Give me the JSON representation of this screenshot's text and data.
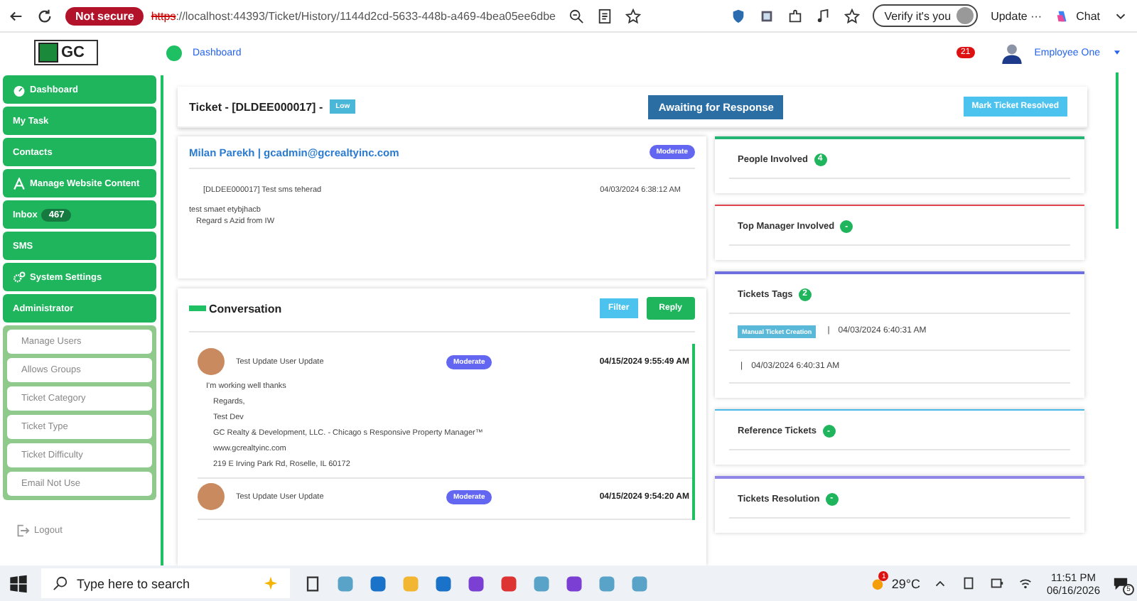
{
  "browser": {
    "security": "Not secure",
    "url_scheme": "https",
    "url_rest": "://localhost:44393/Ticket/History/1144d2cd-5633-448b-a469-4bea05ee6dbe",
    "verify": "Verify it's you",
    "update": "Update",
    "update_more": "···",
    "chat": "Chat"
  },
  "header": {
    "logo": "GC",
    "breadcrumb": "Dashboard",
    "notifications": "21",
    "user": "Employee One"
  },
  "sidebar": {
    "items": [
      {
        "label": "Dashboard",
        "kind": "dashboard"
      },
      {
        "label": "My Task",
        "kind": "plain"
      },
      {
        "label": "Contacts",
        "kind": "plain"
      },
      {
        "label": "Manage Website Content",
        "kind": "content"
      },
      {
        "label": "Inbox",
        "kind": "plain",
        "badge": "467"
      },
      {
        "label": "SMS",
        "kind": "plain"
      },
      {
        "label": "System Settings",
        "kind": "settings"
      },
      {
        "label": "Administrator",
        "kind": "plain",
        "expanded": true,
        "children": [
          "Manage Users",
          "Allows Groups",
          "Ticket Category",
          "Ticket Type",
          "Ticket Difficulty",
          "Email Not Use"
        ]
      }
    ],
    "logout": "Logout"
  },
  "ticket": {
    "title": "Ticket - [DLDEE000017] -",
    "priority": "Low",
    "status_button": "Awaiting for Response",
    "resolve_button": "Mark Ticket Resolved"
  },
  "message": {
    "sender": "Milan Parekh | gcadmin@gcrealtyinc.com",
    "badge": "Moderate",
    "subject": "[DLDEE000017] Test sms teherad",
    "date": "04/03/2024 6:38:12 AM",
    "body": [
      "test smaet etybjhacb",
      "Regard s Azid from IW"
    ]
  },
  "conversation": {
    "title": "Conversation",
    "filter": "Filter",
    "reply": "Reply",
    "entries": [
      {
        "name": "Test Update User Update",
        "badge": "Moderate",
        "date": "04/15/2024 9:55:49 AM",
        "body": [
          "I'm working well thanks",
          "Regards,",
          "Test Dev",
          "GC Realty & Development, LLC. - Chicago s Responsive Property Manager™",
          "www.gcrealtyinc.com",
          "219 E Irving Park Rd, Roselle, IL 60172"
        ]
      },
      {
        "name": "Test Update User Update",
        "badge": "Moderate",
        "date": "04/15/2024 9:54:20 AM"
      }
    ]
  },
  "panels": [
    {
      "title": "People Involved",
      "count": "4",
      "color": "#22b573"
    },
    {
      "title": "Top Manager Involved",
      "count": "-",
      "color": "#e0434b"
    },
    {
      "title": "Tickets Tags",
      "count": "2",
      "color": "#6f6fe0",
      "tags": [
        {
          "tag": "Manual Ticket Creation",
          "separator": "|",
          "date": "04/03/2024 6:40:31 AM"
        },
        {
          "separator": "|",
          "date": "04/03/2024 6:40:31 AM"
        }
      ]
    },
    {
      "title": "Reference Tickets",
      "count": "-",
      "color": "#49b8e8"
    },
    {
      "title": "Tickets Resolution",
      "count": "-",
      "color": "#8f86e8"
    }
  ],
  "taskbar": {
    "search": "Type here to search",
    "weather_badge": "1",
    "temperature": "29°C",
    "time": "11:51 PM",
    "date": "06/16/2026",
    "notification_count": "5"
  }
}
